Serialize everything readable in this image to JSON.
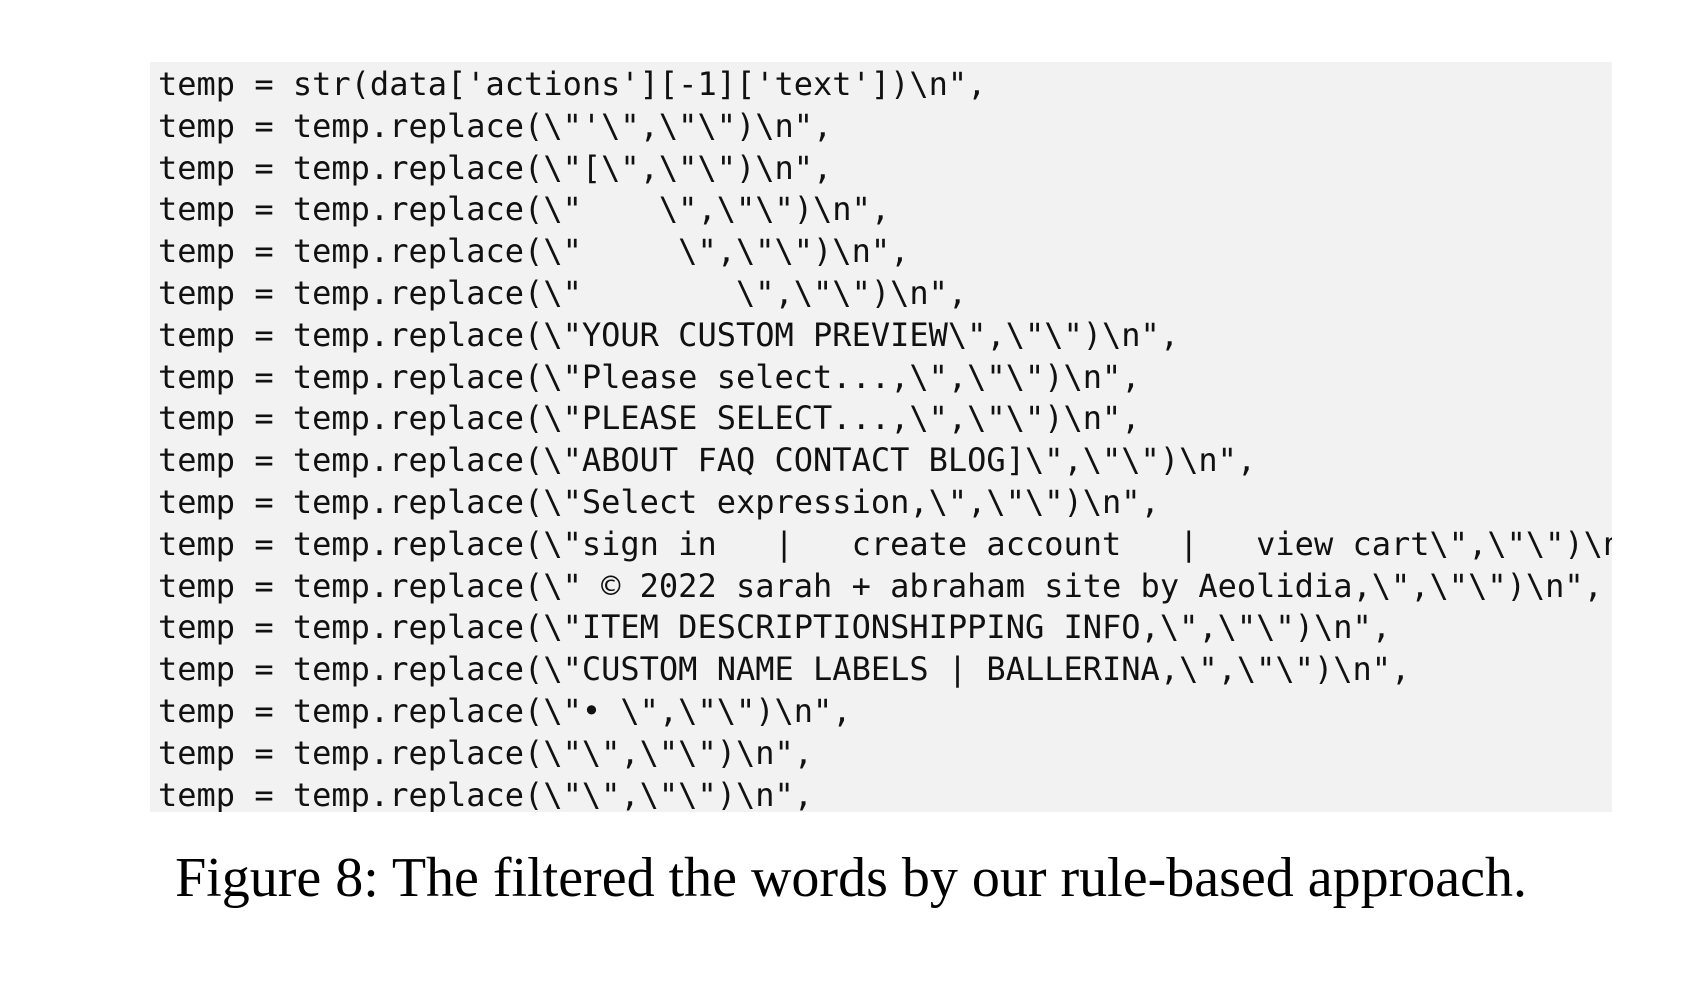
{
  "code_lines": [
    "temp = str(data['actions'][-1]['text'])\\n\",",
    "temp = temp.replace(\\\"'\\\",\\\"\\\")\\n\",",
    "temp = temp.replace(\\\"[\\\",\\\"\\\")\\n\",",
    "temp = temp.replace(\\\"    \\\",\\\"\\\")\\n\",",
    "temp = temp.replace(\\\"     \\\",\\\"\\\")\\n\",",
    "temp = temp.replace(\\\"        \\\",\\\"\\\")\\n\",",
    "temp = temp.replace(\\\"YOUR CUSTOM PREVIEW\\\",\\\"\\\")\\n\",",
    "temp = temp.replace(\\\"Please select...,\\\",\\\"\\\")\\n\",",
    "temp = temp.replace(\\\"PLEASE SELECT...,\\\",\\\"\\\")\\n\",",
    "temp = temp.replace(\\\"ABOUT FAQ CONTACT BLOG]\\\",\\\"\\\")\\n\",",
    "temp = temp.replace(\\\"Select expression,\\\",\\\"\\\")\\n\",",
    "temp = temp.replace(\\\"sign in   |   create account   |   view cart\\\",\\\"\\\")\\n\",",
    "temp = temp.replace(\\\" © 2022 sarah + abraham site by Aeolidia,\\\",\\\"\\\")\\n\",",
    "temp = temp.replace(\\\"ITEM DESCRIPTIONSHIPPING INFO,\\\",\\\"\\\")\\n\",",
    "temp = temp.replace(\\\"CUSTOM NAME LABELS | BALLERINA,\\\",\\\"\\\")\\n\",",
    "temp = temp.replace(\\\"• \\\",\\\"\\\")\\n\",",
    "temp = temp.replace(\\\"\\\",\\\"\\\")\\n\",",
    "temp = temp.replace(\\\"\\\",\\\"\\\")\\n\","
  ],
  "caption": "Figure 8: The filtered the words by our rule-based approach."
}
